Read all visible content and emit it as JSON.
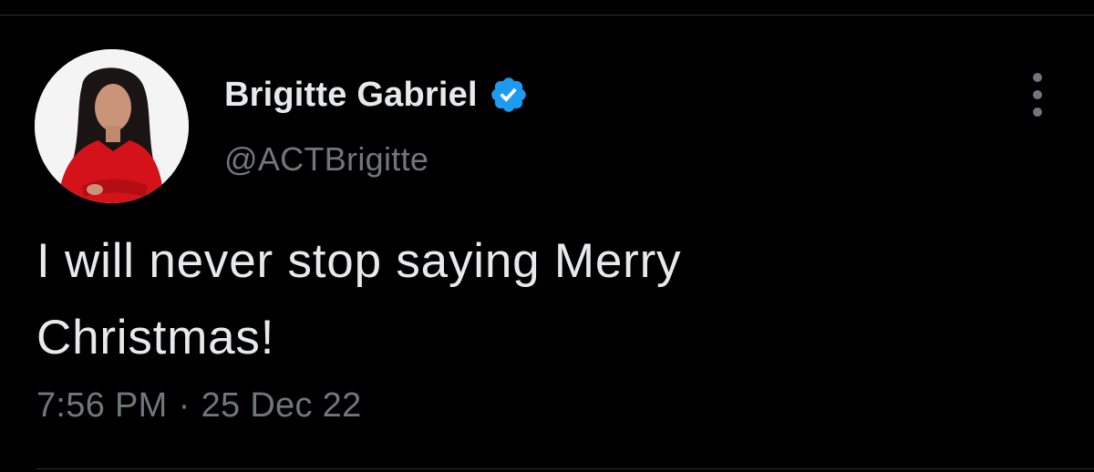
{
  "tweet": {
    "author": {
      "display_name": "Brigitte Gabriel",
      "handle": "@ACTBrigitte",
      "verified": true,
      "avatar_icon": "profile-photo"
    },
    "text": "I will never stop saying Merry Christmas!",
    "time": "7:56 PM",
    "separator": "·",
    "date": "25 Dec 22",
    "more_icon": "more-options-icon"
  },
  "colors": {
    "background": "#000000",
    "text_primary": "#e7e9ea",
    "text_secondary": "#71767b",
    "verified_badge": "#1d9bf0",
    "divider": "#2f3336"
  }
}
